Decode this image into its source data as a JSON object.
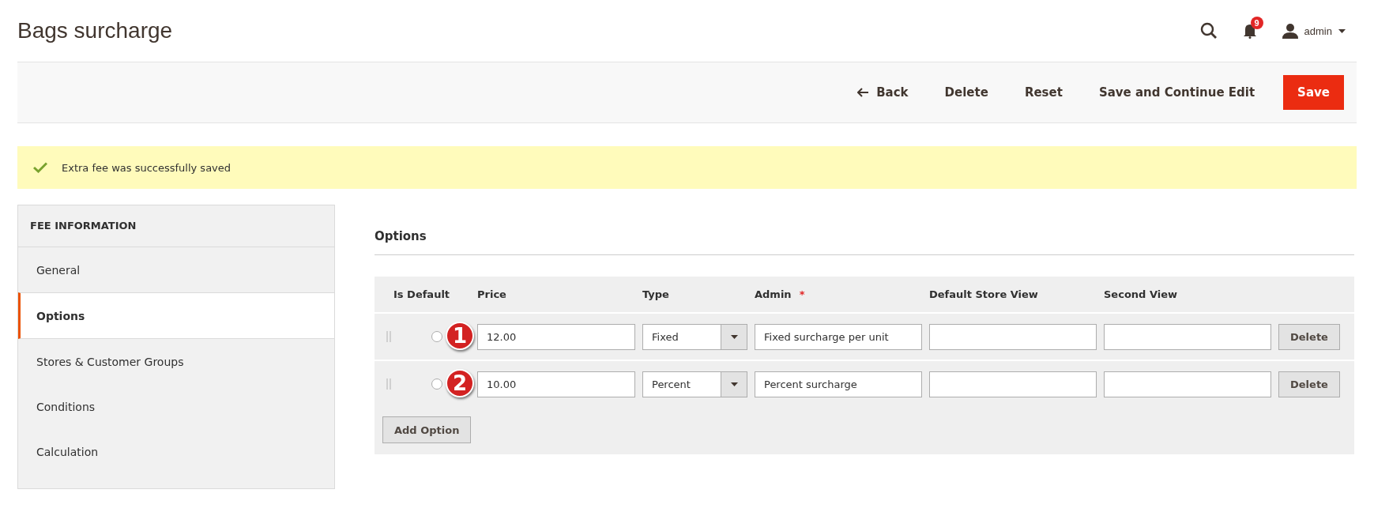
{
  "page_title": "Bags surcharge",
  "header": {
    "notifications_count": "9",
    "user": "admin"
  },
  "actions": [
    {
      "label": "Back",
      "kind": "back"
    },
    {
      "label": "Delete",
      "kind": "plain"
    },
    {
      "label": "Reset",
      "kind": "plain"
    },
    {
      "label": "Save and Continue Edit",
      "kind": "plain"
    },
    {
      "label": "Save",
      "kind": "primary"
    }
  ],
  "message": "Extra fee was successfully saved",
  "sidebar": {
    "title": "FEE INFORMATION",
    "items": [
      {
        "label": "General",
        "selected": false
      },
      {
        "label": "Options",
        "selected": true
      },
      {
        "label": "Stores & Customer Groups",
        "selected": false
      },
      {
        "label": "Conditions",
        "selected": false
      },
      {
        "label": "Calculation",
        "selected": false
      }
    ]
  },
  "section_title": "Options",
  "table": {
    "columns": [
      {
        "label": "Is Default"
      },
      {
        "label": "Price"
      },
      {
        "label": "Type"
      },
      {
        "label": "Admin",
        "required_mark": "*"
      },
      {
        "label": "Default Store View"
      },
      {
        "label": "Second View"
      }
    ],
    "rows": [
      {
        "callout": "1",
        "is_default": false,
        "price": "12.00",
        "type": "Fixed",
        "admin": "Fixed surcharge per unit",
        "default_store_view": "",
        "second_view": "",
        "delete": "Delete"
      },
      {
        "callout": "2",
        "is_default": false,
        "price": "10.00",
        "type": "Percent",
        "admin": "Percent surcharge",
        "default_store_view": "",
        "second_view": "",
        "delete": "Delete"
      }
    ],
    "add_button": "Add Option"
  }
}
